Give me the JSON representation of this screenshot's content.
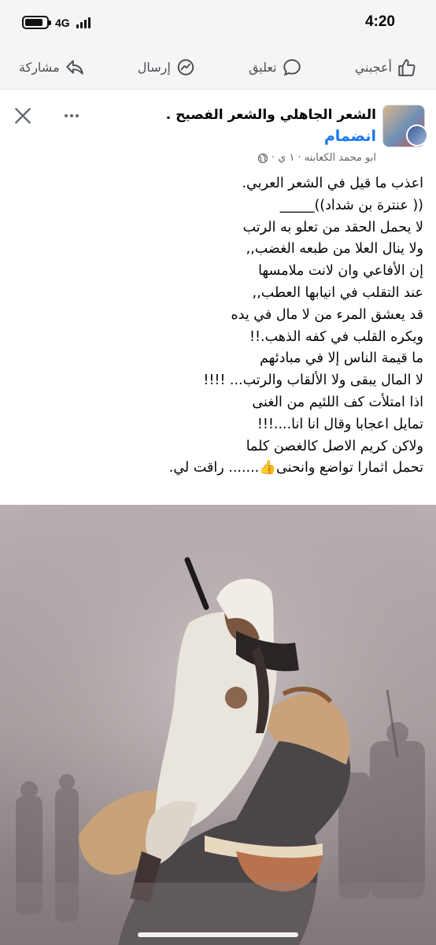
{
  "status_bar": {
    "time": "4:20",
    "network": "4G",
    "icons": [
      "battery-icon",
      "signal-icon"
    ]
  },
  "actions": {
    "like_label": "أعجبني",
    "comment_label": "تعليق",
    "send_label": "إرسال",
    "share_label": "مشاركة",
    "icons": [
      "thumbs-up-icon",
      "comment-bubble-icon",
      "messenger-icon",
      "share-arrow-icon"
    ]
  },
  "post": {
    "group_name": "الشعر الجاهلي والشعر الفصيح .",
    "join_label": "انضمام",
    "author": "ابو محمد الكعابنه",
    "time": "١ ي",
    "lines": [
      "اعذب ما قيل في الشعر العربي.",
      "(( عنترة بن شداد))_____",
      "لا يحمل الحقد من تعلو به الرتب",
      "ولا ينال العلا من طبعه الغضب,,",
      "إن الأفاعي وان لانت ملامسها",
      "عند التقلب في انيابها العطب,,",
      "قد يعشق المرء من لا مال في يده",
      "ويكره القلب في كفه الذهب.!!",
      "ما قيمة الناس إلا في مبادئهم",
      "لا المال يبقى ولا الألقاب والرتب... !!!!",
      "اذا امتلأت كف اللئيم من الغنى",
      "تمايل اعجابا وقال انا انا....!!!",
      "ولاكن كريم الاصل كالغصن كلما",
      "تحمل اثمارا تواضع وانحنى👍....... راقت لي."
    ]
  },
  "colors": {
    "link": "#1877f2",
    "secondary_text": "#65676b",
    "bar_bg": "#f5f5f5"
  }
}
